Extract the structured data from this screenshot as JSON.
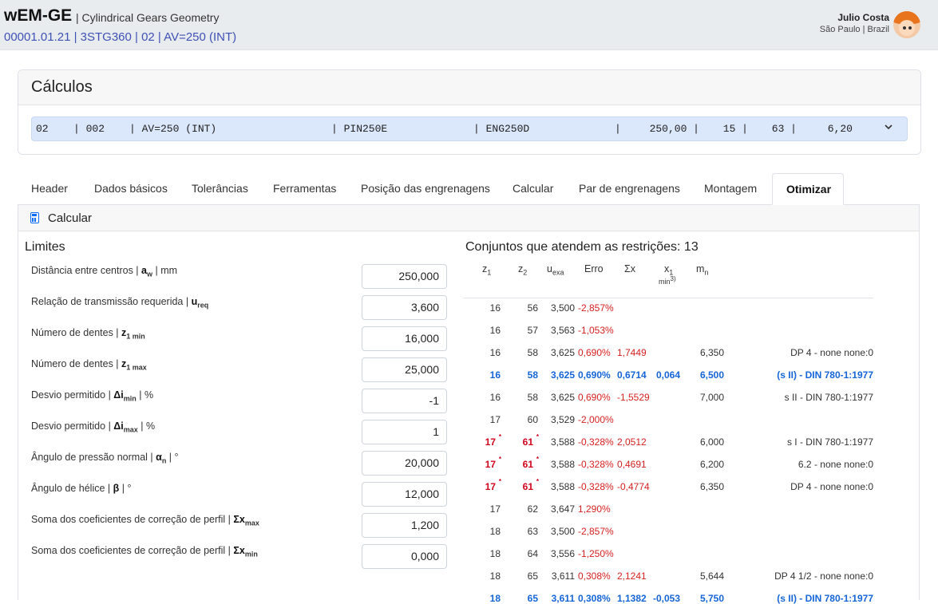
{
  "app": {
    "brand": "wEM-GE",
    "subtitle": "| Cylindrical Gears Geometry",
    "project_code": "00001.01.21 | 3STG360 | 02 | AV=250 (INT)"
  },
  "user": {
    "name": "Julio Costa",
    "location": "São Paulo | Brazil"
  },
  "card": {
    "title": "Cálculos",
    "selected": [
      "02",
      "| 002",
      "| AV=250 (INT)",
      "| PIN250E",
      "| ENG250D",
      "|",
      "250,00 |",
      "15 |",
      "63 |",
      "6,20"
    ]
  },
  "tabs": [
    "Header",
    "Dados básicos",
    "Tolerâncias",
    "Ferramentas",
    "Posição das engrenagens",
    "Calcular",
    "Par de engrenagens",
    "Montagem",
    "Otimizar"
  ],
  "active_tab": "Otimizar",
  "panel": {
    "title": "Calcular"
  },
  "limits": {
    "title": "Limites",
    "rows": [
      {
        "label": "Distância entre centros |",
        "sym": "a",
        "sub": "w",
        "unit": "| mm",
        "value": "250,000"
      },
      {
        "label": "Relação de transmissão requerida |",
        "sym": "u",
        "sub": "req",
        "unit": "",
        "value": "3,600"
      },
      {
        "label": "Número de dentes |",
        "sym": "z",
        "sub": "1 min",
        "unit": "",
        "value": "16,000"
      },
      {
        "label": "Número de dentes |",
        "sym": "z",
        "sub": "1 max",
        "unit": "",
        "value": "25,000"
      },
      {
        "label": "Desvio permitido |",
        "sym": "Δi",
        "sub": "min",
        "unit": "| %",
        "value": "-1"
      },
      {
        "label": "Desvio permitido |",
        "sym": "Δi",
        "sub": "max",
        "unit": "| %",
        "value": "1"
      },
      {
        "label": "Ângulo de pressão normal |",
        "sym": "α",
        "sub": "n",
        "unit": "| °",
        "value": "20,000"
      },
      {
        "label": "Ângulo de hélice |",
        "sym": "β",
        "sub": "",
        "unit": "| °",
        "value": "12,000"
      },
      {
        "label": "Soma dos coeficientes de correção de perfil |",
        "sym": "Σx",
        "sub": "max",
        "unit": "",
        "value": "1,200"
      },
      {
        "label": "Soma dos coeficientes de correção de perfil |",
        "sym": "Σx",
        "sub": "min",
        "unit": "",
        "value": "0,000"
      }
    ]
  },
  "sets": {
    "title": "Conjuntos que atendem as restrições: 13",
    "headers": {
      "z1": "z",
      "z1_sub": "1",
      "z2": "z",
      "z2_sub": "2",
      "u": "u",
      "u_sub": "exa",
      "erro": "Erro",
      "sx": "Σx",
      "x1": "x",
      "x1_sub": "1",
      "x1_sub2": "min",
      "x1_sup": "3)",
      "mn": "m",
      "mn_sub": "n"
    },
    "rows": [
      {
        "z1": "16",
        "z2": "56",
        "u": "3,500",
        "erro": "-2,857%",
        "sx": "",
        "x1": "",
        "mn": "",
        "tool": "",
        "style": "normal"
      },
      {
        "z1": "16",
        "z2": "57",
        "u": "3,563",
        "erro": "-1,053%",
        "sx": "",
        "x1": "",
        "mn": "",
        "tool": "",
        "style": "normal"
      },
      {
        "z1": "16",
        "z2": "58",
        "u": "3,625",
        "erro": "0,690%",
        "sx": "1,7449",
        "x1": "",
        "mn": "6,350",
        "tool": "DP 4 - none none:0",
        "style": "normal"
      },
      {
        "z1": "16",
        "z2": "58",
        "u": "3,625",
        "erro": "0,690%",
        "sx": "0,6714",
        "x1": "0,064",
        "mn": "6,500",
        "tool": "(s II) - DIN 780-1:1977",
        "style": "blue"
      },
      {
        "z1": "16",
        "z2": "58",
        "u": "3,625",
        "erro": "0,690%",
        "sx": "-1,5529",
        "x1": "",
        "mn": "7,000",
        "tool": "s II - DIN 780-1:1977",
        "style": "normal"
      },
      {
        "z1": "17",
        "z2": "60",
        "u": "3,529",
        "erro": "-2,000%",
        "sx": "",
        "x1": "",
        "mn": "",
        "tool": "",
        "style": "normal"
      },
      {
        "z1": "17",
        "z2": "61",
        "u": "3,588",
        "erro": "-0,328%",
        "sx": "2,0512",
        "x1": "",
        "mn": "6,000",
        "tool": "s I - DIN 780-1:1977",
        "style": "star"
      },
      {
        "z1": "17",
        "z2": "61",
        "u": "3,588",
        "erro": "-0,328%",
        "sx": "0,4691",
        "x1": "",
        "mn": "6,200",
        "tool": "6.2 - none none:0",
        "style": "star"
      },
      {
        "z1": "17",
        "z2": "61",
        "u": "3,588",
        "erro": "-0,328%",
        "sx": "-0,4774",
        "x1": "",
        "mn": "6,350",
        "tool": "DP 4 - none none:0",
        "style": "star"
      },
      {
        "z1": "17",
        "z2": "62",
        "u": "3,647",
        "erro": "1,290%",
        "sx": "",
        "x1": "",
        "mn": "",
        "tool": "",
        "style": "normal"
      },
      {
        "z1": "18",
        "z2": "63",
        "u": "3,500",
        "erro": "-2,857%",
        "sx": "",
        "x1": "",
        "mn": "",
        "tool": "",
        "style": "normal"
      },
      {
        "z1": "18",
        "z2": "64",
        "u": "3,556",
        "erro": "-1,250%",
        "sx": "",
        "x1": "",
        "mn": "",
        "tool": "",
        "style": "normal"
      },
      {
        "z1": "18",
        "z2": "65",
        "u": "3,611",
        "erro": "0,308%",
        "sx": "2,1241",
        "x1": "",
        "mn": "5,644",
        "tool": "DP 4 1/2 - none none:0",
        "style": "normal"
      },
      {
        "z1": "18",
        "z2": "65",
        "u": "3,611",
        "erro": "0,308%",
        "sx": "1,1382",
        "x1": "-0,053",
        "mn": "5,750",
        "tool": "(s II) - DIN 780-1:1977",
        "style": "blue"
      }
    ]
  }
}
